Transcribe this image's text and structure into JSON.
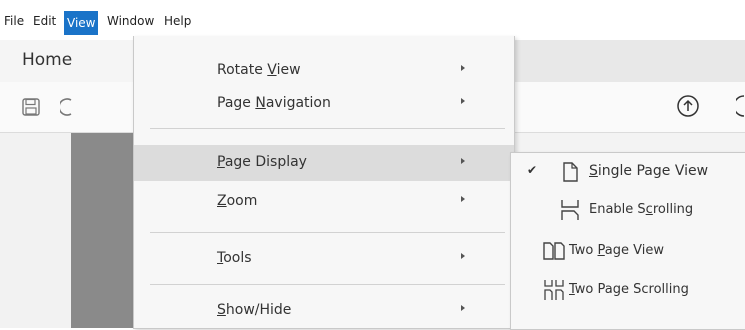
{
  "menubar": {
    "items": [
      {
        "label": "File"
      },
      {
        "label": "Edit"
      },
      {
        "label": "View"
      },
      {
        "label": "Window"
      },
      {
        "label": "Help"
      }
    ]
  },
  "tabs": {
    "home": "Home"
  },
  "view_menu": {
    "items": [
      {
        "prefix": "Rotate ",
        "mnemonic": "V",
        "suffix": "iew",
        "has_submenu": true
      },
      {
        "prefix": "Page ",
        "mnemonic": "N",
        "suffix": "avigation",
        "has_submenu": true
      },
      {
        "prefix": "",
        "mnemonic": "P",
        "suffix": "age Display",
        "has_submenu": true,
        "highlighted": true
      },
      {
        "prefix": "",
        "mnemonic": "Z",
        "suffix": "oom",
        "has_submenu": true
      },
      {
        "prefix": "",
        "mnemonic": "T",
        "suffix": "ools",
        "has_submenu": true
      },
      {
        "prefix": "",
        "mnemonic": "S",
        "suffix": "how/Hide",
        "has_submenu": true
      }
    ]
  },
  "page_display_submenu": {
    "items": [
      {
        "prefix": "",
        "mnemonic": "S",
        "suffix": "ingle Page View",
        "checked": true,
        "icon": "single-page-icon"
      },
      {
        "prefix": "Enable S",
        "mnemonic": "c",
        "suffix": "rolling",
        "checked": false,
        "icon": "scrolling-icon"
      },
      {
        "prefix": "Two ",
        "mnemonic": "P",
        "suffix": "age View",
        "checked": false,
        "icon": "two-page-icon"
      },
      {
        "prefix": "",
        "mnemonic": "T",
        "suffix": "wo Page Scrolling",
        "checked": false,
        "icon": "two-page-scrolling-icon"
      }
    ]
  },
  "colors": {
    "menu_active": "#1a73c8",
    "menu_bg": "#f7f7f7",
    "highlight": "#dcdcdc"
  }
}
